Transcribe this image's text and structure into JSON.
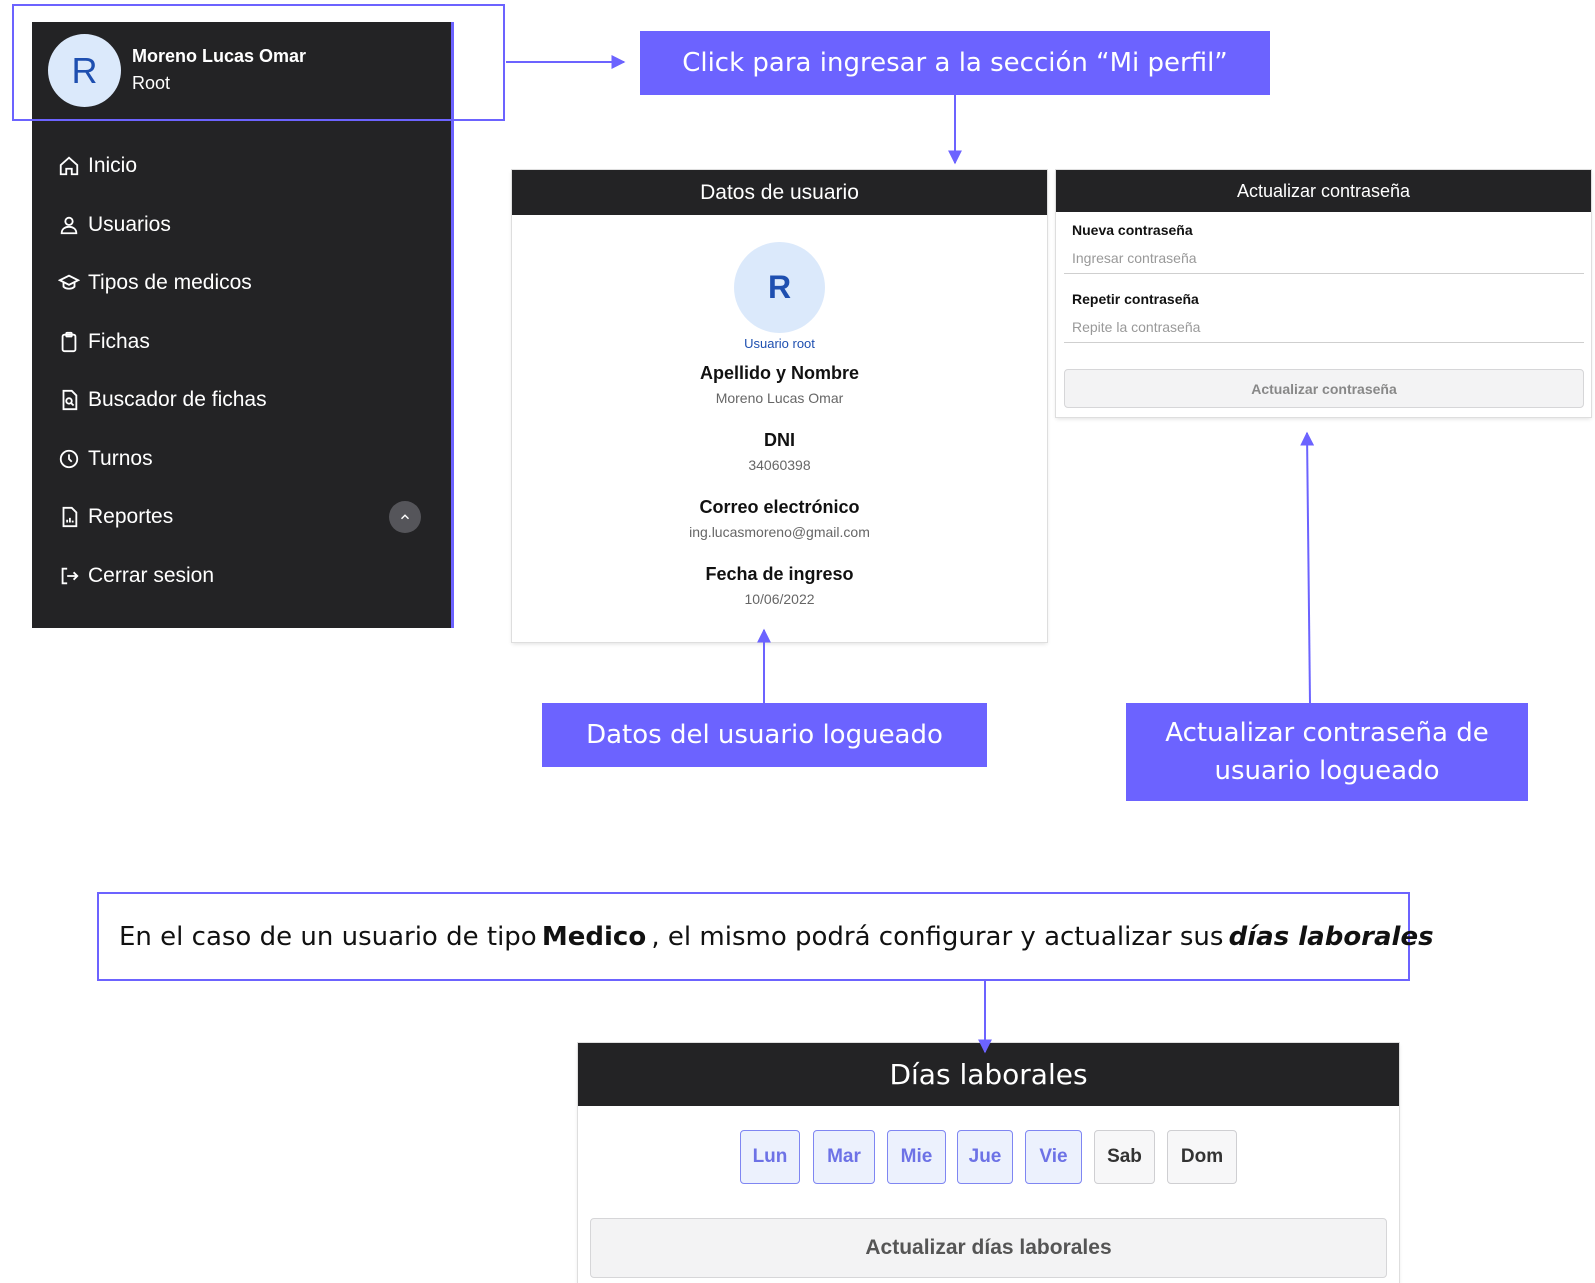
{
  "sidebar": {
    "user_initial": "R",
    "user_name": "Moreno Lucas Omar",
    "user_role": "Root",
    "items": [
      {
        "label": "Inicio",
        "icon": "home-icon"
      },
      {
        "label": "Usuarios",
        "icon": "user-icon"
      },
      {
        "label": "Tipos de medicos",
        "icon": "graduation-cap-icon"
      },
      {
        "label": "Fichas",
        "icon": "clipboard-icon"
      },
      {
        "label": "Buscador de fichas",
        "icon": "search-file-icon"
      },
      {
        "label": "Turnos",
        "icon": "clock-icon"
      },
      {
        "label": "Reportes",
        "icon": "report-icon"
      },
      {
        "label": "Cerrar sesion",
        "icon": "logout-icon"
      }
    ]
  },
  "callouts": {
    "profile": "Click para ingresar a la sección “Mi perfil”",
    "datos": "Datos del usuario logueado",
    "password_line1": "Actualizar contraseña de",
    "password_line2": "usuario logueado"
  },
  "note": {
    "part1": "En el caso de un usuario de tipo",
    "bold": "Medico",
    "part2": ", el mismo podrá configurar y actualizar sus",
    "italic": "días laborales"
  },
  "datos_card": {
    "title": "Datos de usuario",
    "avatar_initial": "R",
    "role_caption": "Usuario root",
    "fields": [
      {
        "label": "Apellido y Nombre",
        "value": "Moreno Lucas Omar"
      },
      {
        "label": "DNI",
        "value": "34060398"
      },
      {
        "label": "Correo electrónico",
        "value": "ing.lucasmoreno@gmail.com"
      },
      {
        "label": "Fecha de ingreso",
        "value": "10/06/2022"
      }
    ]
  },
  "password_card": {
    "title": "Actualizar contraseña",
    "new_label": "Nueva contraseña",
    "new_placeholder": "Ingresar contraseña",
    "repeat_label": "Repetir contraseña",
    "repeat_placeholder": "Repite la contraseña",
    "button": "Actualizar contraseña"
  },
  "dias_card": {
    "title": "Días laborales",
    "days": [
      {
        "label": "Lun",
        "selected": true
      },
      {
        "label": "Mar",
        "selected": true
      },
      {
        "label": "Mie",
        "selected": true
      },
      {
        "label": "Jue",
        "selected": true
      },
      {
        "label": "Vie",
        "selected": true
      },
      {
        "label": "Sab",
        "selected": false
      },
      {
        "label": "Dom",
        "selected": false
      }
    ],
    "button": "Actualizar días laborales"
  },
  "colors": {
    "accent": "#6c63ff",
    "sidebar_bg": "#232325",
    "avatar_bg": "#dbe9fb",
    "avatar_text": "#1e4fb0"
  }
}
